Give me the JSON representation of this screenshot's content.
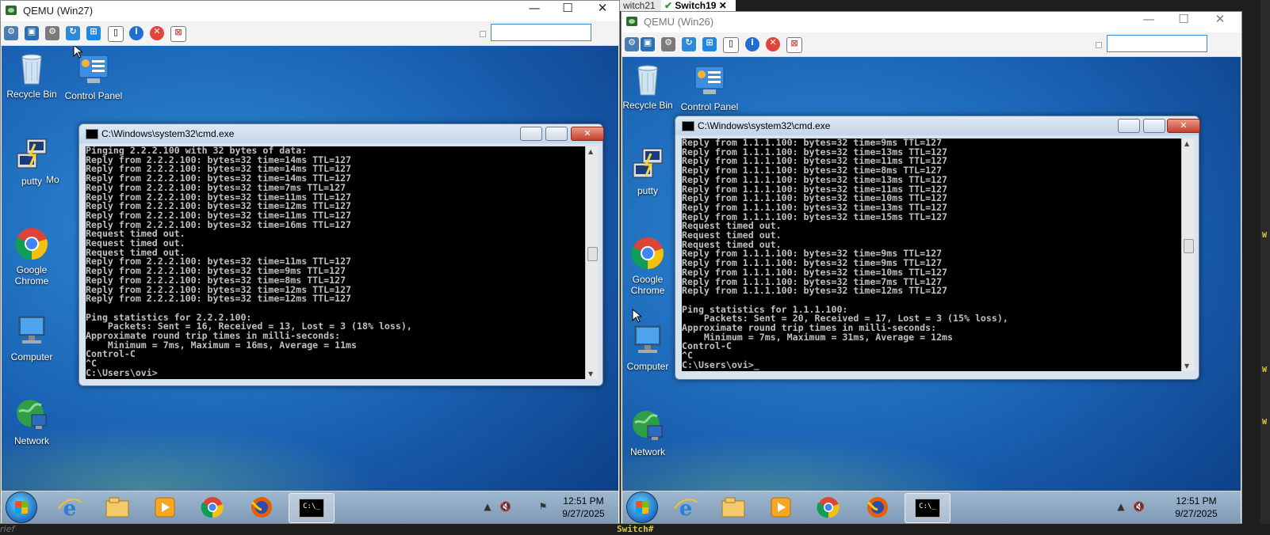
{
  "background": {
    "bottom_left_text": "rief",
    "bottom_right_text": "Switch#",
    "right_edge_letters": [
      "W",
      "W",
      "W"
    ],
    "tabs": [
      {
        "label": "witch21"
      },
      {
        "label": "Switch19",
        "active": true,
        "mark": "✔"
      }
    ]
  },
  "windows": [
    {
      "title": "QEMU (Win27)",
      "controls": {
        "minimize": "—",
        "maximize": "☐",
        "close": "✕"
      },
      "toolbar_icons": [
        "settings-gear-icon",
        "fullscreen-icon",
        "gear-icon",
        "refresh-icon",
        "windows-icon",
        "console-icon",
        "info-icon",
        "stop-icon",
        "disconnect-icon"
      ],
      "desktop_icons": [
        {
          "label": "Recycle Bin"
        },
        {
          "label": "Control Panel"
        },
        {
          "label": "putty"
        },
        {
          "label": "Mo"
        },
        {
          "label": "Google\nChrome"
        },
        {
          "label": "Computer"
        },
        {
          "label": "Network"
        }
      ],
      "cmd": {
        "title": "C:\\Windows\\system32\\cmd.exe",
        "lines": [
          "Pinging 2.2.2.100 with 32 bytes of data:",
          "Reply from 2.2.2.100: bytes=32 time=14ms TTL=127",
          "Reply from 2.2.2.100: bytes=32 time=14ms TTL=127",
          "Reply from 2.2.2.100: bytes=32 time=14ms TTL=127",
          "Reply from 2.2.2.100: bytes=32 time=7ms TTL=127",
          "Reply from 2.2.2.100: bytes=32 time=11ms TTL=127",
          "Reply from 2.2.2.100: bytes=32 time=12ms TTL=127",
          "Reply from 2.2.2.100: bytes=32 time=11ms TTL=127",
          "Reply from 2.2.2.100: bytes=32 time=16ms TTL=127",
          "Request timed out.",
          "Request timed out.",
          "Request timed out.",
          "Reply from 2.2.2.100: bytes=32 time=11ms TTL=127",
          "Reply from 2.2.2.100: bytes=32 time=9ms TTL=127",
          "Reply from 2.2.2.100: bytes=32 time=8ms TTL=127",
          "Reply from 2.2.2.100: bytes=32 time=12ms TTL=127",
          "Reply from 2.2.2.100: bytes=32 time=12ms TTL=127",
          "",
          "Ping statistics for 2.2.2.100:",
          "    Packets: Sent = 16, Received = 13, Lost = 3 (18% loss),",
          "Approximate round trip times in milli-seconds:",
          "    Minimum = 7ms, Maximum = 16ms, Average = 11ms",
          "Control-C",
          "^C",
          "C:\\Users\\ovi>"
        ],
        "scroll_fraction": 0.45
      },
      "taskbar": {
        "time": "12:51 PM",
        "date": "9/27/2025"
      }
    },
    {
      "title": "QEMU (Win26)",
      "controls": {
        "minimize": "—",
        "maximize": "☐",
        "close": "✕"
      },
      "toolbar_icons": [
        "settings-gear-icon",
        "fullscreen-icon",
        "gear-icon",
        "refresh-icon",
        "windows-icon",
        "console-icon",
        "info-icon",
        "stop-icon",
        "disconnect-icon"
      ],
      "desktop_icons": [
        {
          "label": "Recycle Bin"
        },
        {
          "label": "Control Panel"
        },
        {
          "label": "putty"
        },
        {
          "label": "Google\nChrome"
        },
        {
          "label": "Computer"
        },
        {
          "label": "Network"
        }
      ],
      "cmd": {
        "title": "C:\\Windows\\system32\\cmd.exe",
        "lines": [
          "Reply from 1.1.1.100: bytes=32 time=9ms TTL=127",
          "Reply from 1.1.1.100: bytes=32 time=13ms TTL=127",
          "Reply from 1.1.1.100: bytes=32 time=11ms TTL=127",
          "Reply from 1.1.1.100: bytes=32 time=8ms TTL=127",
          "Reply from 1.1.1.100: bytes=32 time=13ms TTL=127",
          "Reply from 1.1.1.100: bytes=32 time=11ms TTL=127",
          "Reply from 1.1.1.100: bytes=32 time=10ms TTL=127",
          "Reply from 1.1.1.100: bytes=32 time=13ms TTL=127",
          "Reply from 1.1.1.100: bytes=32 time=15ms TTL=127",
          "Request timed out.",
          "Request timed out.",
          "Request timed out.",
          "Reply from 1.1.1.100: bytes=32 time=9ms TTL=127",
          "Reply from 1.1.1.100: bytes=32 time=9ms TTL=127",
          "Reply from 1.1.1.100: bytes=32 time=10ms TTL=127",
          "Reply from 1.1.1.100: bytes=32 time=7ms TTL=127",
          "Reply from 1.1.1.100: bytes=32 time=12ms TTL=127",
          "",
          "Ping statistics for 1.1.1.100:",
          "    Packets: Sent = 20, Received = 17, Lost = 3 (15% loss),",
          "Approximate round trip times in milli-seconds:",
          "    Minimum = 7ms, Maximum = 31ms, Average = 12ms",
          "Control-C",
          "^C",
          "C:\\Users\\ovi>_"
        ],
        "scroll_fraction": 0.45
      },
      "taskbar": {
        "time": "12:51 PM",
        "date": "9/27/2025"
      }
    }
  ]
}
